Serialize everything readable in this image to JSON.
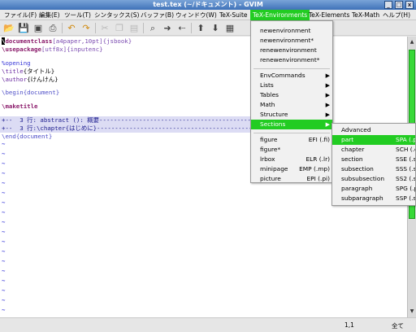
{
  "window": {
    "title": "test.tex (~/ドキュメント) - GVIM",
    "buttons": [
      "_",
      "□",
      "x"
    ]
  },
  "menubar": {
    "items": [
      "ファイル(F)",
      "編集(E)",
      "ツール(T)",
      "シンタックス(S)",
      "バッファ(B)",
      "ウィンドウ(W)",
      "TeX-Suite",
      "TeX-Environments",
      "TeX-Elements",
      "TeX-Math",
      "ヘルプ(H)"
    ],
    "active": "TeX-Environments"
  },
  "toolbar": {
    "icons": [
      "open-icon",
      "save-icon",
      "save-all-icon",
      "print-icon",
      "undo-icon",
      "redo-icon",
      "cut-icon",
      "copy-icon",
      "paste-icon",
      "replace-icon",
      "find-next-icon",
      "find-prev-icon",
      "load-session-icon",
      "save-session-icon",
      "run-script-icon"
    ]
  },
  "editor": {
    "l1_cmd": "\\documentclass",
    "l1_opt": "[a4paper,10pt]",
    "l1_arg": "{jsbook}",
    "l2_cmd": "\\usepackage",
    "l2_opt": "[utf8x]",
    "l2_arg": "{inputenc}",
    "l4": "%opening",
    "l5_cmd": "\\title",
    "l5_arg": "{タイトル}",
    "l6_cmd": "\\author",
    "l6_arg": "{けんけん}",
    "l8_cmd": "\\begin",
    "l8_arg": "{document}",
    "l10_cmd": "\\maketitle",
    "fold1": "+--  3 行: abstract (): 概要------------------------------------------------------------",
    "fold2": "+--  3 行:\\chapter{はじめに}-------------------------------------------------------------",
    "end_cmd": "\\end",
    "end_arg": "{document}",
    "tilde": "~"
  },
  "status": {
    "position": "1,1",
    "scroll": "全て"
  },
  "env_menu": {
    "tearoff": "- - - - - - - - - - - - -",
    "new1": "newenvironment",
    "new2": "newenvironment*",
    "renew1": "renewenvironment",
    "renew2": "renewenvironment*",
    "envcommands": "EnvCommands",
    "lists": "Lists",
    "tables": "Tables",
    "math": "Math",
    "structure": "Structure",
    "sections": "Sections",
    "figure": "figure",
    "figure_sc": "EFI (.fi)",
    "figure_star": "figure*",
    "lrbox": "lrbox",
    "lrbox_sc": "ELR (.lr)",
    "minipage": "minipage",
    "minipage_sc": "EMP (.mp)",
    "picture": "picture",
    "picture_sc": "EPI (.pi)",
    "arrow": "▶"
  },
  "sections_menu": {
    "advanced": "Advanced",
    "items": [
      {
        "label": "part",
        "shortcut": "SPA (.pa)"
      },
      {
        "label": "chapter",
        "shortcut": "SCH (.ch)"
      },
      {
        "label": "section",
        "shortcut": "SSE (.se)"
      },
      {
        "label": "subsection",
        "shortcut": "SSS (.ss)"
      },
      {
        "label": "subsubsection",
        "shortcut": "SS2 (.s2)"
      },
      {
        "label": "paragraph",
        "shortcut": "SPG (.pg)"
      },
      {
        "label": "subparagraph",
        "shortcut": "SSP (.sp)"
      }
    ]
  },
  "colors": {
    "accent": "#22cc22",
    "tilde": "#3a3ad8",
    "fold_bg": "#dcdcf4"
  }
}
